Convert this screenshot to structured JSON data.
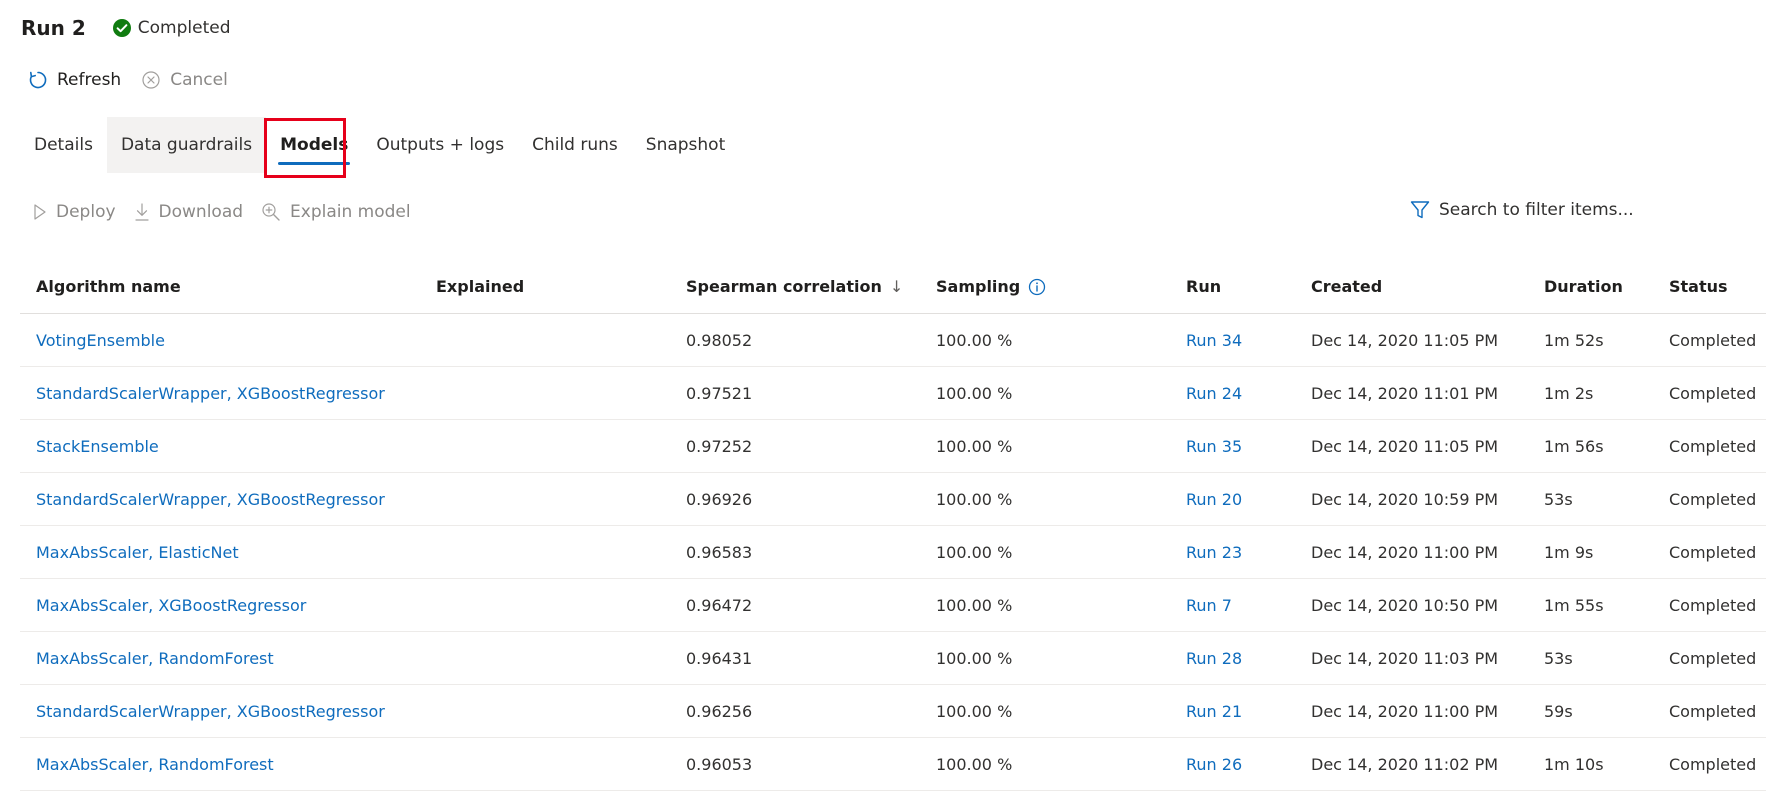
{
  "header": {
    "title": "Run 2",
    "status": "Completed",
    "status_color": "#107c10"
  },
  "commands": {
    "refresh": "Refresh",
    "cancel": "Cancel"
  },
  "tabs": [
    {
      "label": "Details"
    },
    {
      "label": "Data guardrails"
    },
    {
      "label": "Models"
    },
    {
      "label": "Outputs + logs"
    },
    {
      "label": "Child runs"
    },
    {
      "label": "Snapshot"
    }
  ],
  "toolbar": {
    "deploy": "Deploy",
    "download": "Download",
    "explain": "Explain model"
  },
  "search": {
    "placeholder": "Search to filter items..."
  },
  "table": {
    "columns": {
      "algorithm": "Algorithm name",
      "explained": "Explained",
      "spearman": "Spearman correlation",
      "sort_arrow": "↓",
      "sampling": "Sampling",
      "run": "Run",
      "created": "Created",
      "duration": "Duration",
      "status": "Status"
    },
    "rows": [
      {
        "algorithm": "VotingEnsemble",
        "explained": "",
        "spearman": "0.98052",
        "sampling": "100.00 %",
        "run": "Run 34",
        "created": "Dec 14, 2020 11:05 PM",
        "duration": "1m 52s",
        "status": "Completed"
      },
      {
        "algorithm": "StandardScalerWrapper, XGBoostRegressor",
        "explained": "",
        "spearman": "0.97521",
        "sampling": "100.00 %",
        "run": "Run 24",
        "created": "Dec 14, 2020 11:01 PM",
        "duration": "1m 2s",
        "status": "Completed"
      },
      {
        "algorithm": "StackEnsemble",
        "explained": "",
        "spearman": "0.97252",
        "sampling": "100.00 %",
        "run": "Run 35",
        "created": "Dec 14, 2020 11:05 PM",
        "duration": "1m 56s",
        "status": "Completed"
      },
      {
        "algorithm": "StandardScalerWrapper, XGBoostRegressor",
        "explained": "",
        "spearman": "0.96926",
        "sampling": "100.00 %",
        "run": "Run 20",
        "created": "Dec 14, 2020 10:59 PM",
        "duration": "53s",
        "status": "Completed"
      },
      {
        "algorithm": "MaxAbsScaler, ElasticNet",
        "explained": "",
        "spearman": "0.96583",
        "sampling": "100.00 %",
        "run": "Run 23",
        "created": "Dec 14, 2020 11:00 PM",
        "duration": "1m 9s",
        "status": "Completed"
      },
      {
        "algorithm": "MaxAbsScaler, XGBoostRegressor",
        "explained": "",
        "spearman": "0.96472",
        "sampling": "100.00 %",
        "run": "Run 7",
        "created": "Dec 14, 2020 10:50 PM",
        "duration": "1m 55s",
        "status": "Completed"
      },
      {
        "algorithm": "MaxAbsScaler, RandomForest",
        "explained": "",
        "spearman": "0.96431",
        "sampling": "100.00 %",
        "run": "Run 28",
        "created": "Dec 14, 2020 11:03 PM",
        "duration": "53s",
        "status": "Completed"
      },
      {
        "algorithm": "StandardScalerWrapper, XGBoostRegressor",
        "explained": "",
        "spearman": "0.96256",
        "sampling": "100.00 %",
        "run": "Run 21",
        "created": "Dec 14, 2020 11:00 PM",
        "duration": "59s",
        "status": "Completed"
      },
      {
        "algorithm": "MaxAbsScaler, RandomForest",
        "explained": "",
        "spearman": "0.96053",
        "sampling": "100.00 %",
        "run": "Run 26",
        "created": "Dec 14, 2020 11:02 PM",
        "duration": "1m 10s",
        "status": "Completed"
      }
    ]
  },
  "colors": {
    "accent": "#0f6cbd",
    "highlight_box": "#e6001a",
    "disabled_text": "#8a8886"
  },
  "selected_tab": "Models"
}
